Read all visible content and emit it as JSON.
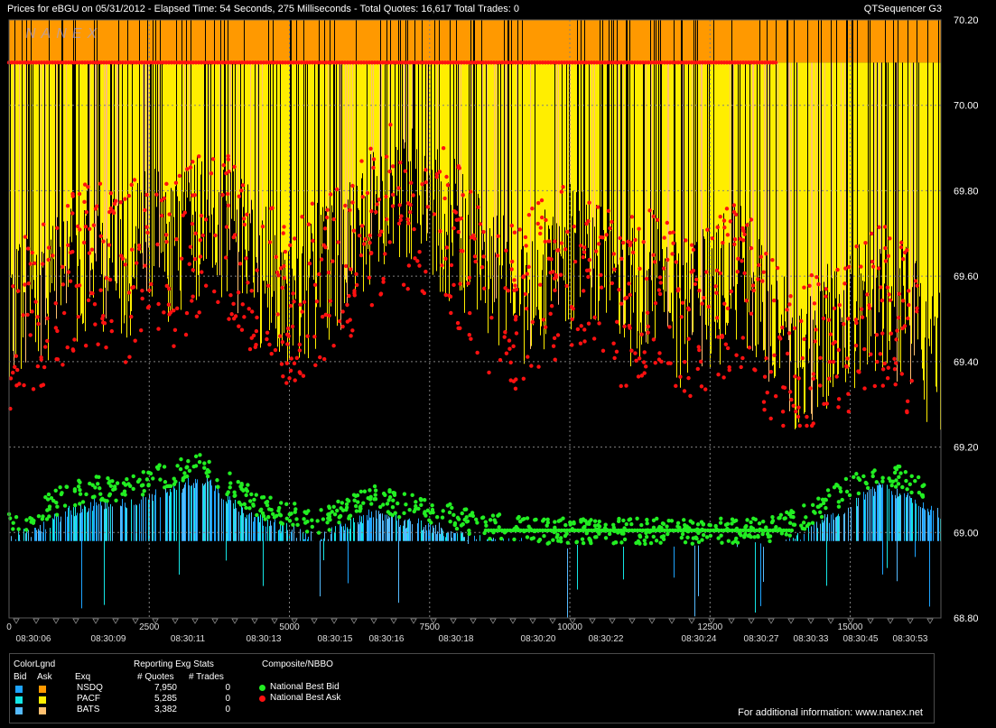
{
  "header": {
    "title": "Prices for  eBGU  on  05/31/2012  -  Elapsed Time: 54 Seconds, 275 Milliseconds  -  Total Quotes: 16,617  Total Trades: 0",
    "app": "QTSequencer G3",
    "watermark": "NANEX"
  },
  "colors": {
    "nsdq_bid": "#1ea4ff",
    "nsdq_ask": "#ff9900",
    "pacf_bid": "#14e6e6",
    "pacf_ask": "#ffee00",
    "bats_bid": "#55bbff",
    "bats_ask": "#ffc070",
    "national_best_bid": "#22ee22",
    "national_best_ask": "#ff1111",
    "grid": "#808080"
  },
  "chart_data": {
    "type": "scatter",
    "y_range": [
      68.8,
      70.2
    ],
    "y_ticks": [
      "70.20",
      "70.00",
      "69.80",
      "69.60",
      "69.40",
      "69.20",
      "69.00",
      "68.80"
    ],
    "x_range": [
      0,
      16617
    ],
    "x_ticks": [
      "0",
      "2500",
      "5000",
      "7500",
      "10000",
      "12500",
      "15000"
    ],
    "time_labels": [
      "08:30:06",
      "08:30:09",
      "08:30:11",
      "08:30:13",
      "08:30:15",
      "08:30:16",
      "08:30:18",
      "08:30:20",
      "08:30:22",
      "08:30:24",
      "08:30:27",
      "08:30:33",
      "08:30:45",
      "08:30:53"
    ],
    "grid": true,
    "series": [
      {
        "name": "National Best Ask",
        "x": [
          0,
          500,
          1000,
          1500,
          2000,
          2500,
          3000,
          3500,
          4000,
          4500,
          5000,
          5500,
          6000,
          6500,
          7000,
          7500,
          8000,
          8500,
          9000,
          9500,
          10000,
          10500,
          11000,
          11500,
          12000,
          12500,
          13000,
          13500,
          14000,
          14500,
          15000,
          15500,
          16000,
          16500
        ],
        "values": [
          69.5,
          69.55,
          69.6,
          69.65,
          69.6,
          69.7,
          69.65,
          69.75,
          69.7,
          69.6,
          69.55,
          69.6,
          69.65,
          69.75,
          69.8,
          69.75,
          69.7,
          69.6,
          69.55,
          69.6,
          69.65,
          69.6,
          69.55,
          69.6,
          69.5,
          69.55,
          69.6,
          69.5,
          69.4,
          69.45,
          69.5,
          69.55,
          69.5,
          69.4
        ]
      },
      {
        "name": "National Best Bid",
        "x": [
          0,
          500,
          1000,
          1500,
          2000,
          2500,
          3000,
          3500,
          4000,
          4500,
          5000,
          5500,
          6000,
          6500,
          7000,
          7500,
          8000,
          8500,
          9000,
          9500,
          10000,
          10500,
          11000,
          11500,
          12000,
          12500,
          13000,
          13500,
          14000,
          14500,
          15000,
          15500,
          16000,
          16500
        ],
        "values": [
          69.02,
          69.04,
          69.08,
          69.1,
          69.1,
          69.12,
          69.14,
          69.16,
          69.1,
          69.06,
          69.04,
          69.02,
          69.05,
          69.08,
          69.06,
          69.05,
          69.03,
          69.01,
          69.01,
          69.0,
          69.0,
          69.0,
          69.0,
          69.0,
          69.0,
          69.0,
          69.0,
          69.0,
          69.02,
          69.06,
          69.1,
          69.14,
          69.12,
          69.08
        ]
      }
    ]
  },
  "legend": {
    "colorlgnd": "ColorLgnd",
    "bid_header": "Bid",
    "ask_header": "Ask",
    "exq_header": "Exq",
    "stats_title": "Reporting Exg Stats",
    "quotes_header": "# Quotes",
    "trades_header": "# Trades",
    "composite_title": "Composite/NBBO",
    "rows": [
      {
        "exchange": "NSDQ",
        "quotes": "7,950",
        "trades": "0"
      },
      {
        "exchange": "PACF",
        "quotes": "5,285",
        "trades": "0"
      },
      {
        "exchange": "BATS",
        "quotes": "3,382",
        "trades": "0"
      }
    ],
    "nbb_label": "National Best Bid",
    "nba_label": "National Best Ask",
    "footer": "For additional information: www.nanex.net"
  }
}
